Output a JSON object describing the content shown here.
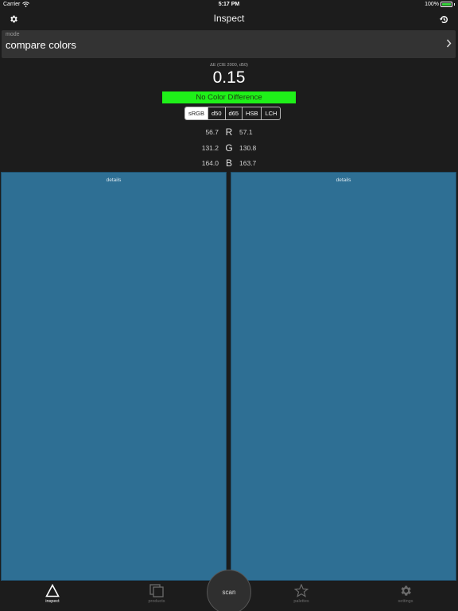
{
  "status": {
    "carrier": "Carrier",
    "time": "5:17 PM",
    "battery": "100%",
    "battery_level": 1.0
  },
  "nav": {
    "title": "Inspect",
    "left_icon": "gear-icon",
    "right_icon": "history-icon"
  },
  "mode": {
    "label": "mode",
    "value": "compare colors"
  },
  "delta_e": {
    "label": "ΔE (CIE 2000, d50)",
    "value": "0.15",
    "verdict": "No Color Difference",
    "verdict_color": "#1ff019"
  },
  "color_spaces": {
    "options": [
      "sRGB",
      "d50",
      "d65",
      "HSB",
      "LCH"
    ],
    "selected": "sRGB"
  },
  "channels": [
    {
      "name": "R",
      "left": "56.7",
      "right": "57.1"
    },
    {
      "name": "G",
      "left": "131.2",
      "right": "130.8"
    },
    {
      "name": "B",
      "left": "164.0",
      "right": "163.7"
    }
  ],
  "swatches": {
    "left": {
      "label": "details",
      "color": "#2e6f94"
    },
    "right": {
      "label": "details",
      "color": "#2e6f94"
    }
  },
  "tabs": [
    {
      "label": "inspect",
      "icon": "triangle-icon",
      "active": true
    },
    {
      "label": "products",
      "icon": "stack-icon",
      "active": false
    },
    {
      "label": "palettes",
      "icon": "star-icon",
      "active": false
    },
    {
      "label": "settings",
      "icon": "gear-icon",
      "active": false
    }
  ],
  "scan": {
    "label": "scan"
  }
}
